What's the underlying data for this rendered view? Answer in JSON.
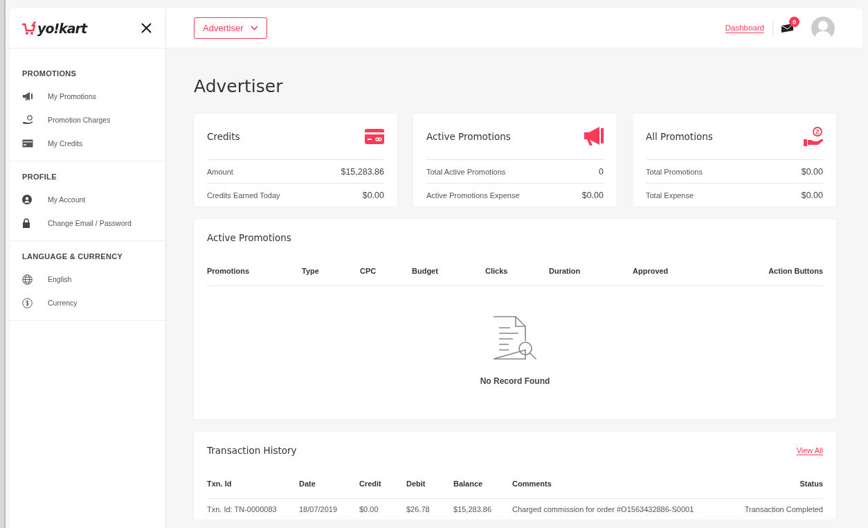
{
  "sidebar": {
    "logo": "yo!kart",
    "sections": [
      {
        "title": "PROMOTIONS",
        "items": [
          {
            "label": "My Promotions"
          },
          {
            "label": "Promotion Charges"
          },
          {
            "label": "My Credits"
          }
        ]
      },
      {
        "title": "PROFILE",
        "items": [
          {
            "label": "My Account"
          },
          {
            "label": "Change Email / Password"
          }
        ]
      },
      {
        "title": "LANGUAGE & CURRENCY",
        "items": [
          {
            "label": "English"
          },
          {
            "label": "Currency"
          }
        ]
      }
    ]
  },
  "header": {
    "role_dropdown": "Advertiser",
    "dashboard_link": "Dashboard",
    "notification_count": "0"
  },
  "page_title": "Advertiser",
  "stat_cards": [
    {
      "title": "Credits",
      "rows": [
        {
          "label": "Amount",
          "value": "$15,283.86"
        },
        {
          "label": "Credits Earned Today",
          "value": "$0.00"
        }
      ]
    },
    {
      "title": "Active Promotions",
      "rows": [
        {
          "label": "Total Active Promotions",
          "value": "0"
        },
        {
          "label": "Active Promotions Expense",
          "value": "$0.00"
        }
      ]
    },
    {
      "title": "All Promotions",
      "rows": [
        {
          "label": "Total Promotions",
          "value": "$0.00"
        },
        {
          "label": "Total Expense",
          "value": "$0.00"
        }
      ]
    }
  ],
  "active_promotions": {
    "title": "Active Promotions",
    "columns": [
      "Promotions",
      "Type",
      "CPC",
      "Budget",
      "Clicks",
      "Duration",
      "Approved",
      "Action Buttons"
    ],
    "empty_text": "No Record Found"
  },
  "transaction_history": {
    "title": "Transaction History",
    "view_all": "View All",
    "columns": [
      "Txn. Id",
      "Date",
      "Credit",
      "Debit",
      "Balance",
      "Comments",
      "Status"
    ],
    "rows": [
      [
        "Txn. Id: TN-0000083",
        "18/07/2019",
        "$0.00",
        "$26.78",
        "$15,283.86",
        "Charged commission for order #O1563432886-S0001",
        "Transaction Completed"
      ]
    ]
  }
}
